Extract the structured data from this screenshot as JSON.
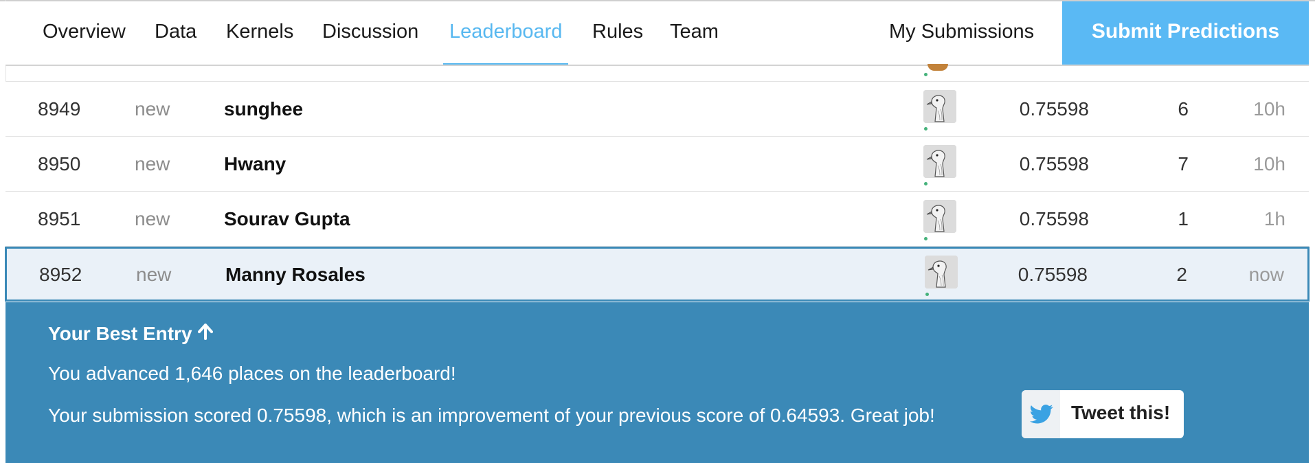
{
  "nav": {
    "tabs": [
      {
        "label": "Overview",
        "active": false
      },
      {
        "label": "Data",
        "active": false
      },
      {
        "label": "Kernels",
        "active": false
      },
      {
        "label": "Discussion",
        "active": false
      },
      {
        "label": "Leaderboard",
        "active": true
      },
      {
        "label": "Rules",
        "active": false
      },
      {
        "label": "Team",
        "active": false
      }
    ],
    "my_submissions": "My Submissions",
    "submit_predictions": "Submit Predictions"
  },
  "leaderboard": {
    "rows": [
      {
        "rank": "8949",
        "change": "new",
        "team": "sunghee",
        "avatar_icon": "goose-avatar-icon",
        "score": "0.75598",
        "entries": "6",
        "last": "10h"
      },
      {
        "rank": "8950",
        "change": "new",
        "team": "Hwany",
        "avatar_icon": "goose-avatar-icon",
        "score": "0.75598",
        "entries": "7",
        "last": "10h"
      },
      {
        "rank": "8951",
        "change": "new",
        "team": "Sourav Gupta",
        "avatar_icon": "goose-avatar-icon",
        "score": "0.75598",
        "entries": "1",
        "last": "1h"
      },
      {
        "rank": "8952",
        "change": "new",
        "team": "Manny Rosales",
        "avatar_icon": "goose-avatar-icon",
        "score": "0.75598",
        "entries": "2",
        "last": "now",
        "is_current_user": true
      }
    ]
  },
  "banner": {
    "title": "Your Best Entry",
    "title_icon": "arrow-up-icon",
    "advanced": "You advanced 1,646 places on the leaderboard!",
    "scored": "Your submission scored 0.75598, which is an improvement of your previous score of 0.64593. Great job!",
    "tweet_label": "Tweet this!",
    "tweet_icon": "twitter-bird-icon"
  },
  "colors": {
    "accent": "#58b8f0",
    "submit_button": "#5ab9f4",
    "banner": "#3b89b7",
    "highlight_row": "#eaf1f8",
    "online_dot": "#45b27b"
  }
}
